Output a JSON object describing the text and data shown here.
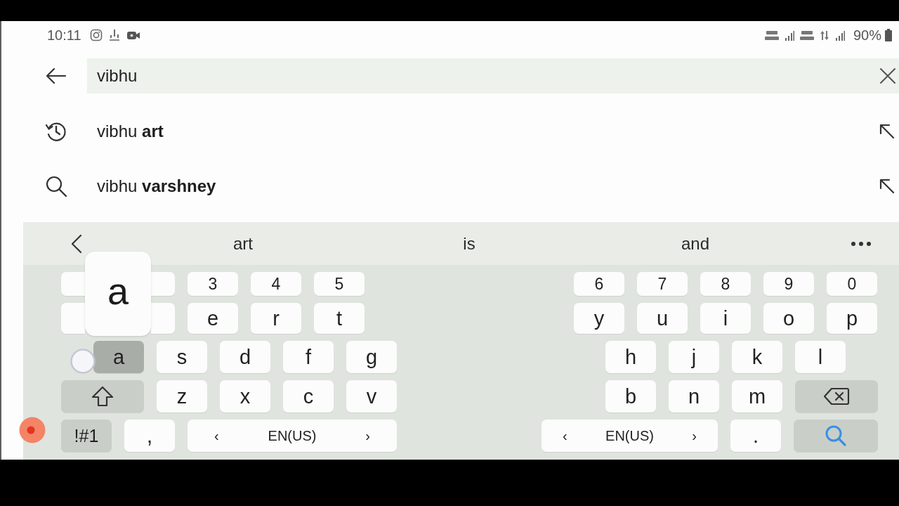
{
  "status_bar": {
    "time": "10:11",
    "battery": "90%"
  },
  "search": {
    "value": "vibhu"
  },
  "suggestions": [
    {
      "kind": "history",
      "text": "vibhu **art**"
    },
    {
      "kind": "search",
      "text": "vibhu **varshney**"
    }
  ],
  "keyboard": {
    "candidates": [
      "art",
      "is",
      "and"
    ],
    "key_preview": {
      "label": "a"
    },
    "left_rows": [
      [
        {
          "kind": "covered",
          "pressed": false
        },
        {
          "kind": "covered",
          "pressed": false
        },
        {
          "kind": "char",
          "label": "3",
          "pressed": false
        },
        {
          "kind": "char",
          "label": "4",
          "pressed": false
        },
        {
          "kind": "char",
          "label": "5",
          "pressed": false
        }
      ],
      [
        {
          "kind": "covered",
          "pressed": false
        },
        {
          "kind": "covered",
          "pressed": false
        },
        {
          "kind": "char",
          "label": "e",
          "pressed": false
        },
        {
          "kind": "char",
          "label": "r",
          "pressed": false
        },
        {
          "kind": "char",
          "label": "t",
          "pressed": false
        }
      ],
      [
        {
          "kind": "char",
          "label": "a",
          "pressed": true
        },
        {
          "kind": "char",
          "label": "s",
          "pressed": false
        },
        {
          "kind": "char",
          "label": "d",
          "pressed": false
        },
        {
          "kind": "char",
          "label": "f",
          "pressed": false
        },
        {
          "kind": "char",
          "label": "g",
          "pressed": false
        }
      ],
      [
        {
          "kind": "shift",
          "pressed": false
        },
        {
          "kind": "char",
          "label": "z",
          "pressed": false
        },
        {
          "kind": "char",
          "label": "x",
          "pressed": false
        },
        {
          "kind": "char",
          "label": "c",
          "pressed": false
        },
        {
          "kind": "char",
          "label": "v",
          "pressed": false
        }
      ],
      [
        {
          "kind": "symbols",
          "label": "!#1",
          "pressed": false
        },
        {
          "kind": "char",
          "label": ",",
          "pressed": false
        },
        {
          "kind": "space",
          "prev": "‹",
          "label": "EN(US)",
          "next": "›",
          "pressed": false
        }
      ]
    ],
    "right_rows": [
      [
        {
          "kind": "char",
          "label": "6",
          "pressed": false
        },
        {
          "kind": "char",
          "label": "7",
          "pressed": false
        },
        {
          "kind": "char",
          "label": "8",
          "pressed": false
        },
        {
          "kind": "char",
          "label": "9",
          "pressed": false
        },
        {
          "kind": "char",
          "label": "0",
          "pressed": false
        }
      ],
      [
        {
          "kind": "char",
          "label": "y",
          "pressed": false
        },
        {
          "kind": "char",
          "label": "u",
          "pressed": false
        },
        {
          "kind": "char",
          "label": "i",
          "pressed": false
        },
        {
          "kind": "char",
          "label": "o",
          "pressed": false
        },
        {
          "kind": "char",
          "label": "p",
          "pressed": false
        }
      ],
      [
        {
          "kind": "char",
          "label": "h",
          "pressed": false
        },
        {
          "kind": "char",
          "label": "j",
          "pressed": false
        },
        {
          "kind": "char",
          "label": "k",
          "pressed": false
        },
        {
          "kind": "char",
          "label": "l",
          "pressed": false
        }
      ],
      [
        {
          "kind": "char",
          "label": "b",
          "pressed": false
        },
        {
          "kind": "char",
          "label": "n",
          "pressed": false
        },
        {
          "kind": "char",
          "label": "m",
          "pressed": false
        },
        {
          "kind": "backspace",
          "pressed": false
        }
      ],
      [
        {
          "kind": "space",
          "prev": "‹",
          "label": "EN(US)",
          "next": "›",
          "pressed": false
        },
        {
          "kind": "char",
          "label": ".",
          "pressed": false
        },
        {
          "kind": "search",
          "pressed": false
        }
      ]
    ]
  }
}
